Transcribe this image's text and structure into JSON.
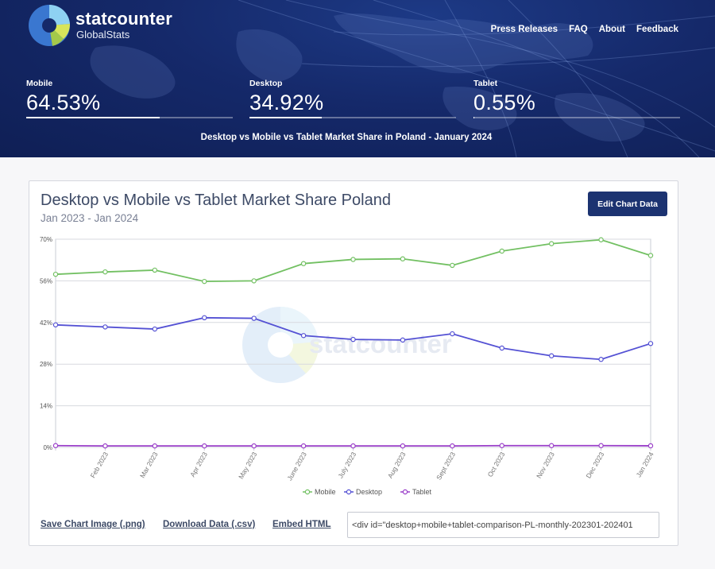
{
  "header": {
    "brand": "statcounter",
    "brand_sub": "GlobalStats",
    "nav": [
      "Press Releases",
      "FAQ",
      "About",
      "Feedback"
    ],
    "stats": [
      {
        "label": "Mobile",
        "value": "64.53%",
        "share": 0.6453
      },
      {
        "label": "Desktop",
        "value": "34.92%",
        "share": 0.3492
      },
      {
        "label": "Tablet",
        "value": "0.55%",
        "share": 0.0055
      }
    ],
    "title": "Desktop vs Mobile vs Tablet Market Share in Poland - January 2024"
  },
  "chart_card": {
    "title": "Desktop vs Mobile vs Tablet Market Share Poland",
    "subtitle": "Jan 2023 - Jan 2024",
    "edit_button": "Edit Chart Data",
    "watermark": "statcounter"
  },
  "chart_data": {
    "type": "line",
    "categories": [
      "Jan 2023",
      "Feb 2023",
      "Mar 2023",
      "Apr 2023",
      "May 2023",
      "June 2023",
      "July 2023",
      "Aug 2023",
      "Sept 2023",
      "Oct 2023",
      "Nov 2023",
      "Dec 2023",
      "Jan 2024"
    ],
    "x_tick_labels": [
      "Feb 2023",
      "Mar 2023",
      "Apr 2023",
      "May 2023",
      "June 2023",
      "July 2023",
      "Aug 2023",
      "Sept 2023",
      "Oct 2023",
      "Nov 2023",
      "Dec 2023",
      "Jan 2024"
    ],
    "y_ticks": [
      "0%",
      "14%",
      "28%",
      "42%",
      "56%",
      "70%"
    ],
    "ylim": [
      0,
      70
    ],
    "grid": true,
    "legend_position": "bottom",
    "series": [
      {
        "name": "Mobile",
        "color": "#72c062",
        "values": [
          58.2,
          59.0,
          59.6,
          55.8,
          56.0,
          61.8,
          63.2,
          63.4,
          61.2,
          66.0,
          68.5,
          69.8,
          64.53
        ]
      },
      {
        "name": "Desktop",
        "color": "#5451d4",
        "values": [
          41.2,
          40.5,
          39.8,
          43.6,
          43.4,
          37.6,
          36.3,
          36.1,
          38.2,
          33.4,
          30.8,
          29.6,
          34.92
        ]
      },
      {
        "name": "Tablet",
        "color": "#9a3fc9",
        "values": [
          0.6,
          0.5,
          0.5,
          0.5,
          0.5,
          0.5,
          0.5,
          0.5,
          0.5,
          0.6,
          0.6,
          0.6,
          0.55
        ]
      }
    ]
  },
  "footer_links": {
    "save_image": "Save Chart Image (.png)",
    "download": "Download Data (.csv)",
    "embed": "Embed HTML",
    "embed_code": "<div id=\"desktop+mobile+tablet-comparison-PL-monthly-202301-202401"
  }
}
